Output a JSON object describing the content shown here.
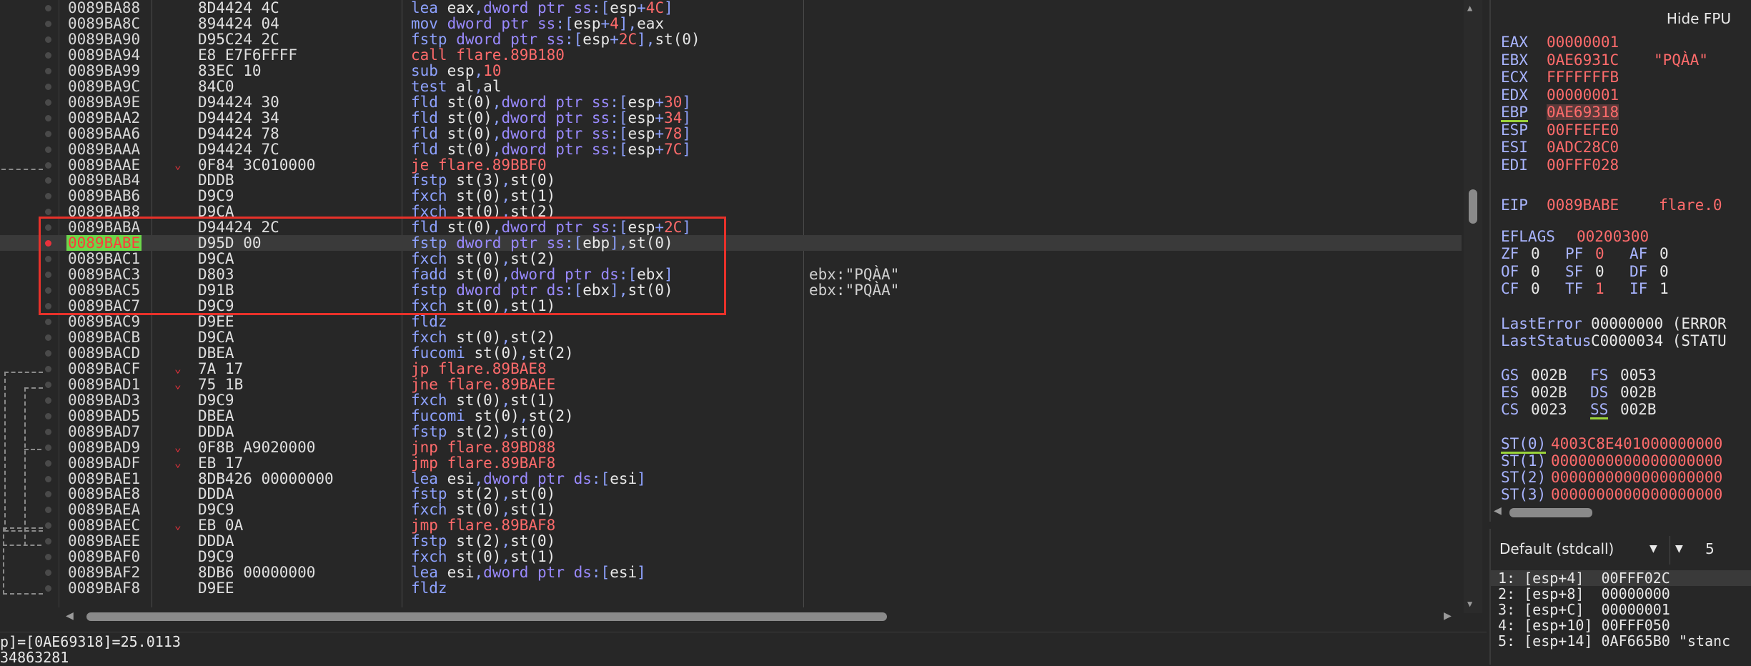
{
  "disasm": {
    "rows": [
      {
        "addr": "0089BA88",
        "bytes": "8D4424 4C",
        "parts": [
          [
            "mn",
            "lea "
          ],
          [
            "reg",
            "eax"
          ],
          [
            "mn",
            ","
          ],
          [
            "kw",
            "dword ptr "
          ],
          [
            "kw",
            "ss"
          ],
          [
            "mn",
            ":["
          ],
          [
            "reg",
            "esp"
          ],
          [
            "mn",
            "+"
          ],
          [
            "num",
            "4C"
          ],
          [
            "mn",
            "]"
          ]
        ]
      },
      {
        "addr": "0089BA8C",
        "bytes": "894424 04",
        "parts": [
          [
            "mn",
            "mov "
          ],
          [
            "kw",
            "dword ptr "
          ],
          [
            "kw",
            "ss"
          ],
          [
            "mn",
            ":["
          ],
          [
            "reg",
            "esp"
          ],
          [
            "mn",
            "+"
          ],
          [
            "num",
            "4"
          ],
          [
            "mn",
            "],"
          ],
          [
            "reg",
            "eax"
          ]
        ]
      },
      {
        "addr": "0089BA90",
        "bytes": "D95C24 2C",
        "parts": [
          [
            "mn",
            "fstp "
          ],
          [
            "kw",
            "dword ptr "
          ],
          [
            "kw",
            "ss"
          ],
          [
            "mn",
            ":["
          ],
          [
            "reg",
            "esp"
          ],
          [
            "mn",
            "+"
          ],
          [
            "num",
            "2C"
          ],
          [
            "mn",
            "],"
          ],
          [
            "reg",
            "st(0)"
          ]
        ]
      },
      {
        "addr": "0089BA94",
        "bytes": "E8 E7F6FFFF",
        "parts": [
          [
            "call",
            "call flare.89B180"
          ]
        ]
      },
      {
        "addr": "0089BA99",
        "bytes": "83EC 10",
        "parts": [
          [
            "mn",
            "sub "
          ],
          [
            "reg",
            "esp"
          ],
          [
            "mn",
            ","
          ],
          [
            "num",
            "10"
          ]
        ]
      },
      {
        "addr": "0089BA9C",
        "bytes": "84C0",
        "parts": [
          [
            "mn",
            "test "
          ],
          [
            "reg",
            "al"
          ],
          [
            "mn",
            ","
          ],
          [
            "reg",
            "al"
          ]
        ]
      },
      {
        "addr": "0089BA9E",
        "bytes": "D94424 30",
        "parts": [
          [
            "mn",
            "fld "
          ],
          [
            "reg",
            "st(0)"
          ],
          [
            "mn",
            ","
          ],
          [
            "kw",
            "dword ptr "
          ],
          [
            "kw",
            "ss"
          ],
          [
            "mn",
            ":["
          ],
          [
            "reg",
            "esp"
          ],
          [
            "mn",
            "+"
          ],
          [
            "num",
            "30"
          ],
          [
            "mn",
            "]"
          ]
        ]
      },
      {
        "addr": "0089BAA2",
        "bytes": "D94424 34",
        "parts": [
          [
            "mn",
            "fld "
          ],
          [
            "reg",
            "st(0)"
          ],
          [
            "mn",
            ","
          ],
          [
            "kw",
            "dword ptr "
          ],
          [
            "kw",
            "ss"
          ],
          [
            "mn",
            ":["
          ],
          [
            "reg",
            "esp"
          ],
          [
            "mn",
            "+"
          ],
          [
            "num",
            "34"
          ],
          [
            "mn",
            "]"
          ]
        ]
      },
      {
        "addr": "0089BAA6",
        "bytes": "D94424 78",
        "parts": [
          [
            "mn",
            "fld "
          ],
          [
            "reg",
            "st(0)"
          ],
          [
            "mn",
            ","
          ],
          [
            "kw",
            "dword ptr "
          ],
          [
            "kw",
            "ss"
          ],
          [
            "mn",
            ":["
          ],
          [
            "reg",
            "esp"
          ],
          [
            "mn",
            "+"
          ],
          [
            "num",
            "78"
          ],
          [
            "mn",
            "]"
          ]
        ]
      },
      {
        "addr": "0089BAAA",
        "bytes": "D94424 7C",
        "parts": [
          [
            "mn",
            "fld "
          ],
          [
            "reg",
            "st(0)"
          ],
          [
            "mn",
            ","
          ],
          [
            "kw",
            "dword ptr "
          ],
          [
            "kw",
            "ss"
          ],
          [
            "mn",
            ":["
          ],
          [
            "reg",
            "esp"
          ],
          [
            "mn",
            "+"
          ],
          [
            "num",
            "7C"
          ],
          [
            "mn",
            "]"
          ]
        ]
      },
      {
        "addr": "0089BAAE",
        "bytes": "0F84 3C010000",
        "arrow": "⌄",
        "parts": [
          [
            "br",
            "je flare.89BBF0"
          ]
        ]
      },
      {
        "addr": "0089BAB4",
        "bytes": "DDDB",
        "parts": [
          [
            "mn",
            "fstp "
          ],
          [
            "reg",
            "st(3)"
          ],
          [
            "mn",
            ","
          ],
          [
            "reg",
            "st(0)"
          ]
        ]
      },
      {
        "addr": "0089BAB6",
        "bytes": "D9C9",
        "parts": [
          [
            "mn",
            "fxch "
          ],
          [
            "reg",
            "st(0)"
          ],
          [
            "mn",
            ","
          ],
          [
            "reg",
            "st(1)"
          ]
        ]
      },
      {
        "addr": "0089BAB8",
        "bytes": "D9CA",
        "parts": [
          [
            "mn",
            "fxch "
          ],
          [
            "reg",
            "st(0)"
          ],
          [
            "mn",
            ","
          ],
          [
            "reg",
            "st(2)"
          ]
        ]
      },
      {
        "addr": "0089BABA",
        "bytes": "D94424 2C",
        "parts": [
          [
            "mn",
            "fld "
          ],
          [
            "reg",
            "st(0)"
          ],
          [
            "mn",
            ","
          ],
          [
            "kw",
            "dword ptr "
          ],
          [
            "kw",
            "ss"
          ],
          [
            "mn",
            ":["
          ],
          [
            "reg",
            "esp"
          ],
          [
            "mn",
            "+"
          ],
          [
            "num",
            "2C"
          ],
          [
            "mn",
            "]"
          ]
        ]
      },
      {
        "addr": "0089BABE",
        "bytes": "D95D 00",
        "eip": true,
        "parts": [
          [
            "mn",
            "fstp "
          ],
          [
            "kw",
            "dword ptr "
          ],
          [
            "kw",
            "ss"
          ],
          [
            "mn",
            ":["
          ],
          [
            "reg",
            "ebp"
          ],
          [
            "mn",
            "],"
          ],
          [
            "reg",
            "st(0)"
          ]
        ]
      },
      {
        "addr": "0089BAC1",
        "bytes": "D9CA",
        "parts": [
          [
            "mn",
            "fxch "
          ],
          [
            "reg",
            "st(0)"
          ],
          [
            "mn",
            ","
          ],
          [
            "reg",
            "st(2)"
          ]
        ]
      },
      {
        "addr": "0089BAC3",
        "bytes": "D803",
        "comment": "ebx:\"PQÀA\"",
        "parts": [
          [
            "mn",
            "fadd "
          ],
          [
            "reg",
            "st(0)"
          ],
          [
            "mn",
            ","
          ],
          [
            "kw",
            "dword ptr "
          ],
          [
            "kw",
            "ds"
          ],
          [
            "mn",
            ":["
          ],
          [
            "reg",
            "ebx"
          ],
          [
            "mn",
            "]"
          ]
        ]
      },
      {
        "addr": "0089BAC5",
        "bytes": "D91B",
        "comment": "ebx:\"PQÀA\"",
        "parts": [
          [
            "mn",
            "fstp "
          ],
          [
            "kw",
            "dword ptr "
          ],
          [
            "kw",
            "ds"
          ],
          [
            "mn",
            ":["
          ],
          [
            "reg",
            "ebx"
          ],
          [
            "mn",
            "],"
          ],
          [
            "reg",
            "st(0)"
          ]
        ]
      },
      {
        "addr": "0089BAC7",
        "bytes": "D9C9",
        "parts": [
          [
            "mn",
            "fxch "
          ],
          [
            "reg",
            "st(0)"
          ],
          [
            "mn",
            ","
          ],
          [
            "reg",
            "st(1)"
          ]
        ]
      },
      {
        "addr": "0089BAC9",
        "bytes": "D9EE",
        "parts": [
          [
            "mn",
            "fldz"
          ]
        ]
      },
      {
        "addr": "0089BACB",
        "bytes": "D9CA",
        "parts": [
          [
            "mn",
            "fxch "
          ],
          [
            "reg",
            "st(0)"
          ],
          [
            "mn",
            ","
          ],
          [
            "reg",
            "st(2)"
          ]
        ]
      },
      {
        "addr": "0089BACD",
        "bytes": "DBEA",
        "parts": [
          [
            "mn",
            "fucomi "
          ],
          [
            "reg",
            "st(0)"
          ],
          [
            "mn",
            ","
          ],
          [
            "reg",
            "st(2)"
          ]
        ]
      },
      {
        "addr": "0089BACF",
        "bytes": "7A 17",
        "arrow": "⌄",
        "parts": [
          [
            "br",
            "jp flare.89BAE8"
          ]
        ]
      },
      {
        "addr": "0089BAD1",
        "bytes": "75 1B",
        "arrow": "⌄",
        "parts": [
          [
            "br",
            "jne flare.89BAEE"
          ]
        ]
      },
      {
        "addr": "0089BAD3",
        "bytes": "D9C9",
        "parts": [
          [
            "mn",
            "fxch "
          ],
          [
            "reg",
            "st(0)"
          ],
          [
            "mn",
            ","
          ],
          [
            "reg",
            "st(1)"
          ]
        ]
      },
      {
        "addr": "0089BAD5",
        "bytes": "DBEA",
        "parts": [
          [
            "mn",
            "fucomi "
          ],
          [
            "reg",
            "st(0)"
          ],
          [
            "mn",
            ","
          ],
          [
            "reg",
            "st(2)"
          ]
        ]
      },
      {
        "addr": "0089BAD7",
        "bytes": "DDDA",
        "parts": [
          [
            "mn",
            "fstp "
          ],
          [
            "reg",
            "st(2)"
          ],
          [
            "mn",
            ","
          ],
          [
            "reg",
            "st(0)"
          ]
        ]
      },
      {
        "addr": "0089BAD9",
        "bytes": "0F8B A9020000",
        "arrow": "⌄",
        "parts": [
          [
            "br",
            "jnp flare.89BD88"
          ]
        ]
      },
      {
        "addr": "0089BADF",
        "bytes": "EB 17",
        "arrow": "⌄",
        "parts": [
          [
            "br",
            "jmp flare.89BAF8"
          ]
        ]
      },
      {
        "addr": "0089BAE1",
        "bytes": "8DB426 00000000",
        "parts": [
          [
            "mn",
            "lea "
          ],
          [
            "reg",
            "esi"
          ],
          [
            "mn",
            ","
          ],
          [
            "kw",
            "dword ptr "
          ],
          [
            "kw",
            "ds"
          ],
          [
            "mn",
            ":["
          ],
          [
            "reg",
            "esi"
          ],
          [
            "mn",
            "]"
          ]
        ]
      },
      {
        "addr": "0089BAE8",
        "bytes": "DDDA",
        "parts": [
          [
            "mn",
            "fstp "
          ],
          [
            "reg",
            "st(2)"
          ],
          [
            "mn",
            ","
          ],
          [
            "reg",
            "st(0)"
          ]
        ]
      },
      {
        "addr": "0089BAEA",
        "bytes": "D9C9",
        "parts": [
          [
            "mn",
            "fxch "
          ],
          [
            "reg",
            "st(0)"
          ],
          [
            "mn",
            ","
          ],
          [
            "reg",
            "st(1)"
          ]
        ]
      },
      {
        "addr": "0089BAEC",
        "bytes": "EB 0A",
        "arrow": "⌄",
        "parts": [
          [
            "br",
            "jmp flare.89BAF8"
          ]
        ]
      },
      {
        "addr": "0089BAEE",
        "bytes": "DDDA",
        "parts": [
          [
            "mn",
            "fstp "
          ],
          [
            "reg",
            "st(2)"
          ],
          [
            "mn",
            ","
          ],
          [
            "reg",
            "st(0)"
          ]
        ]
      },
      {
        "addr": "0089BAF0",
        "bytes": "D9C9",
        "parts": [
          [
            "mn",
            "fxch "
          ],
          [
            "reg",
            "st(0)"
          ],
          [
            "mn",
            ","
          ],
          [
            "reg",
            "st(1)"
          ]
        ]
      },
      {
        "addr": "0089BAF2",
        "bytes": "8DB6 00000000",
        "parts": [
          [
            "mn",
            "lea "
          ],
          [
            "reg",
            "esi"
          ],
          [
            "mn",
            ","
          ],
          [
            "kw",
            "dword ptr "
          ],
          [
            "kw",
            "ds"
          ],
          [
            "mn",
            ":["
          ],
          [
            "reg",
            "esi"
          ],
          [
            "mn",
            "]"
          ]
        ]
      },
      {
        "addr": "0089BAF8",
        "bytes": "D9EE",
        "parts": [
          [
            "mn",
            "fldz"
          ]
        ]
      }
    ]
  },
  "info": {
    "line1": "p]=[0AE69318]=25.0113",
    "line2": "34863281"
  },
  "registers": {
    "hide_fpu_label": "Hide FPU",
    "gpr": [
      {
        "name": "EAX",
        "value": "00000001",
        "extra": ""
      },
      {
        "name": "EBX",
        "value": "0AE6931C",
        "extra": "\"PQÀA\""
      },
      {
        "name": "ECX",
        "value": "FFFFFFFB",
        "extra": ""
      },
      {
        "name": "EDX",
        "value": "00000001",
        "extra": ""
      },
      {
        "name": "EBP",
        "value": "0AE69318",
        "extra": "",
        "changed": true,
        "underline": true
      },
      {
        "name": "ESP",
        "value": "00FFEFE0",
        "extra": ""
      },
      {
        "name": "ESI",
        "value": "0ADC28C0",
        "extra": ""
      },
      {
        "name": "EDI",
        "value": "00FFF028",
        "extra": ""
      }
    ],
    "eip": {
      "name": "EIP",
      "value": "0089BABE",
      "extra": "flare.0"
    },
    "eflags": {
      "name": "EFLAGS",
      "value": "00200300"
    },
    "flags": [
      [
        {
          "n": "ZF",
          "v": "0"
        },
        {
          "n": "PF",
          "v": "0",
          "red": true
        },
        {
          "n": "AF",
          "v": "0"
        }
      ],
      [
        {
          "n": "OF",
          "v": "0"
        },
        {
          "n": "SF",
          "v": "0"
        },
        {
          "n": "DF",
          "v": "0"
        }
      ],
      [
        {
          "n": "CF",
          "v": "0"
        },
        {
          "n": "TF",
          "v": "1",
          "red": true
        },
        {
          "n": "IF",
          "v": "1"
        }
      ]
    ],
    "last_error": {
      "name": "LastError",
      "value": "00000000 (ERROR"
    },
    "last_status": {
      "name": "LastStatus",
      "value": "C0000034 (STATU"
    },
    "segs": [
      [
        {
          "n": "GS",
          "v": "002B"
        },
        {
          "n": "FS",
          "v": "0053"
        }
      ],
      [
        {
          "n": "ES",
          "v": "002B"
        },
        {
          "n": "DS",
          "v": "002B"
        }
      ],
      [
        {
          "n": "CS",
          "v": "0023"
        },
        {
          "n": "SS",
          "v": "002B",
          "underline": true
        }
      ]
    ],
    "fpu": [
      {
        "name": "ST(0)",
        "value": "4003C8E401000000000",
        "underline": true
      },
      {
        "name": "ST(1)",
        "value": "0000000000000000000"
      },
      {
        "name": "ST(2)",
        "value": "0000000000000000000"
      },
      {
        "name": "ST(3)",
        "value": "0000000000000000000"
      }
    ]
  },
  "callconv": {
    "selected": "Default (stdcall)",
    "arg_count": "5"
  },
  "stack_args": [
    "1: [esp+4]  00FFF02C",
    "2: [esp+8]  00000000",
    "3: [esp+C]  00000001",
    "4: [esp+10] 00FFF050",
    "5: [esp+14] 0AF665B0 \"stanc"
  ],
  "colors": {
    "background": "#272727",
    "mnemonic": "#8ea2ff",
    "branch": "#ff6b6b",
    "eip_highlight": "#6cd64a",
    "breakpoint": "#e8323c",
    "annotation_box": "#e8312a"
  }
}
